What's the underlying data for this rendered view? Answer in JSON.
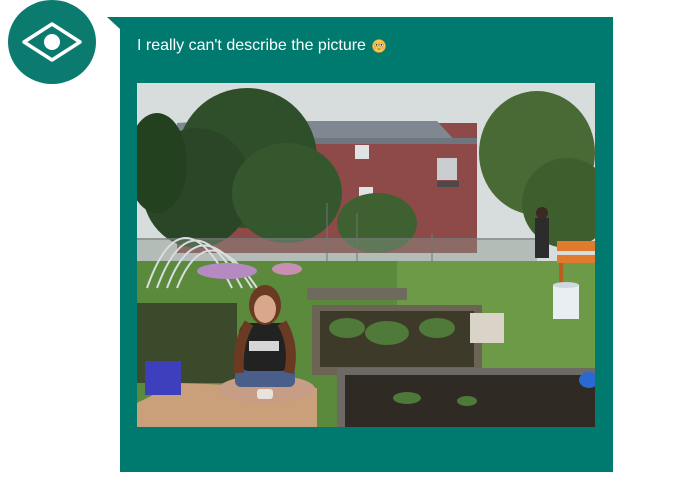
{
  "chat": {
    "avatar_icon": "eye-diamond-icon",
    "message": {
      "text": "I really can't describe the picture",
      "emoji": "flushed-face-emoji"
    },
    "image": {
      "subject": "garden-photo"
    }
  },
  "colors": {
    "accent": "#007a6e",
    "avatar_bg": "#0b7a6f",
    "text": "#ffffff"
  }
}
